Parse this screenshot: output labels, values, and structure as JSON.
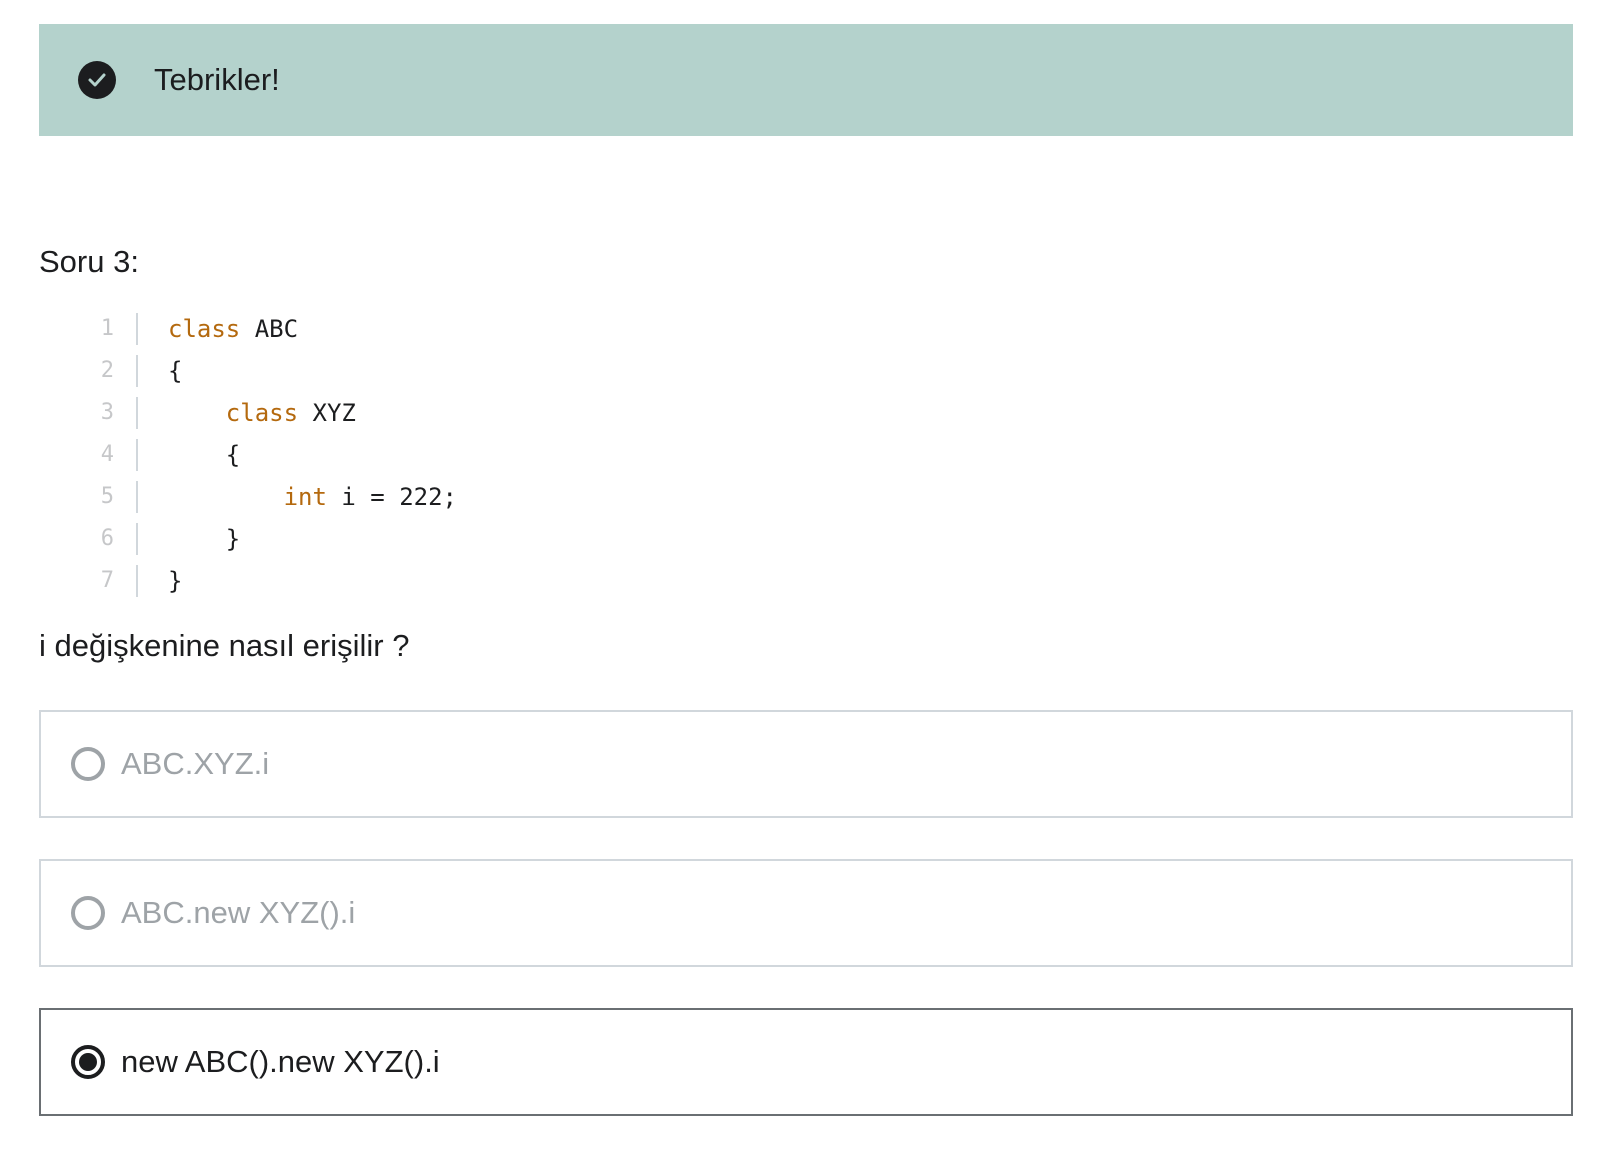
{
  "alert": {
    "icon": "check-circle-icon",
    "message": "Tebrikler!",
    "background": "#b4d2cc"
  },
  "question": {
    "title": "Soru 3:",
    "code": [
      {
        "num": "1",
        "indent": "",
        "keyword": "class",
        "rest": " ABC"
      },
      {
        "num": "2",
        "indent": "",
        "keyword": "",
        "rest": "{"
      },
      {
        "num": "3",
        "indent": "    ",
        "keyword": "class",
        "rest": " XYZ"
      },
      {
        "num": "4",
        "indent": "    ",
        "keyword": "",
        "rest": "{"
      },
      {
        "num": "5",
        "indent": "        ",
        "keyword": "int",
        "rest": " i = 222;"
      },
      {
        "num": "6",
        "indent": "    ",
        "keyword": "",
        "rest": "}"
      },
      {
        "num": "7",
        "indent": "",
        "keyword": "",
        "rest": "}"
      }
    ],
    "prompt": "i değişkenine nasıl erişilir ?",
    "keyword_color": "#b4690e"
  },
  "options": [
    {
      "label": "ABC.XYZ.i",
      "selected": false
    },
    {
      "label": "ABC.new XYZ().i",
      "selected": false
    },
    {
      "label": "new ABC().new XYZ().i",
      "selected": true
    }
  ]
}
